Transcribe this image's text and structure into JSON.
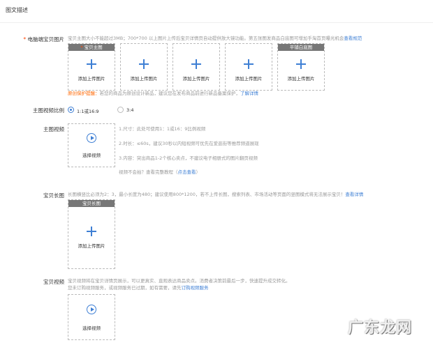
{
  "header": {
    "title": "图文描述"
  },
  "main_images": {
    "label": "电脑端宝贝图片",
    "note_text": "宝贝主图大小不能超过3MB；700*700 以上图片上传后宝贝详情页自动提供放大镜功能。第五张图发商品白底图可增加手淘首页曝光机会",
    "note_link": "查看规范",
    "slots": [
      {
        "tag": "宝贝主图",
        "caption": "添加上传图片"
      },
      {
        "tag": "",
        "caption": "添加上传图片"
      },
      {
        "tag": "",
        "caption": "添加上传图片"
      },
      {
        "tag": "",
        "caption": "添加上传图片"
      },
      {
        "tag": "平铺白底图",
        "caption": "添加上传图片"
      }
    ],
    "protect_title": "原创保护提醒：",
    "protect_text": "若您的商品为原创设计新品，建议您在发布商品前进行新品备案保护，",
    "protect_link": "了解详情"
  },
  "ratio": {
    "label": "主图视频比例",
    "options": [
      "1:1或16:9",
      "3:4"
    ]
  },
  "main_video": {
    "label": "主图视频",
    "caption": "选择视频",
    "tip1": "1.尺寸：此处可使用1：1或16：9比例视频",
    "tip2": "2.时长：≤60s，建议30秒以内短视频可优先在爱逛街等推荐频道展现",
    "tip3": "3.内容：突出商品1-2个核心卖点，不建议电子相册式的图片翻页视频",
    "howto_text": "视频不会拍？查看完整教程（",
    "howto_link": "点击查看",
    "howto_end": "）"
  },
  "long_image": {
    "label": "宝贝长图",
    "note_text": "长图横竖比必须为2：3，最小长度为480；建议使用800*1200，若不上传长图，搜索列表、市场活动等页面的竖图模式将无法展示宝贝！",
    "note_link": "查看详情",
    "tag": "宝贝长图",
    "caption": "添加上传图片"
  },
  "item_video": {
    "label": "宝贝视频",
    "note1": "宝贝视频将在宝贝详情页展示，可以更真实、直观表达商品卖点。消费者决策前最后一步，快速提升成交转化。",
    "note2_text": "您未订购视频服务，或视频服务已过期，如有需要，请先",
    "note2_link": "订购视频服务",
    "caption": "选择视频"
  },
  "watermark": "广东龙网"
}
